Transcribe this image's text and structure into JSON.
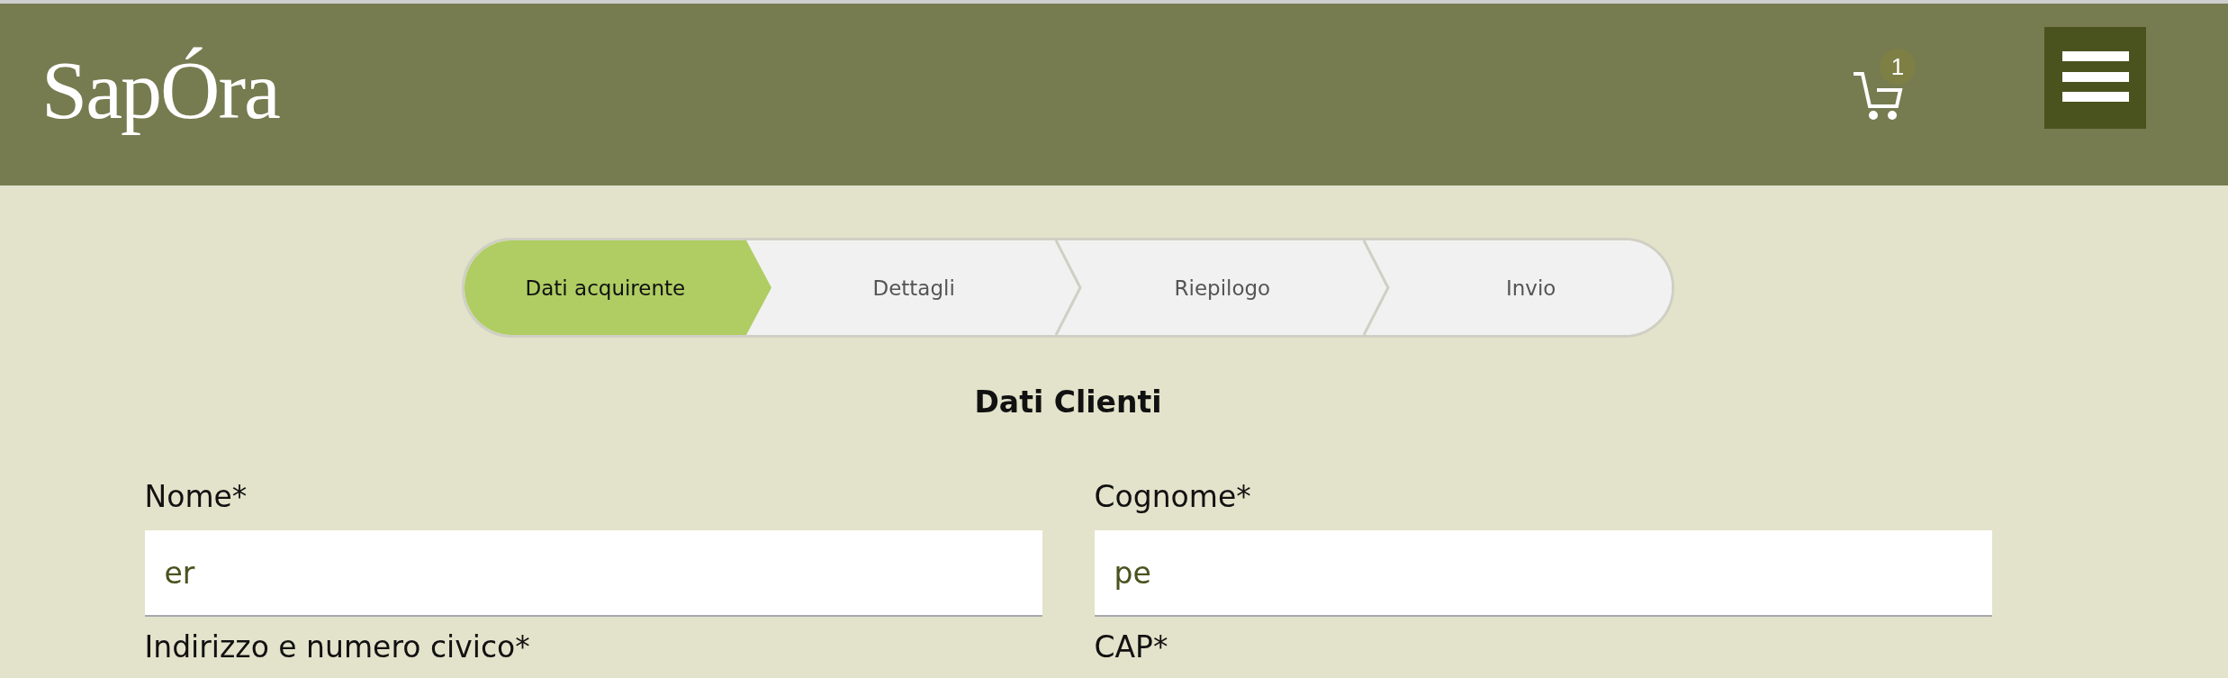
{
  "header": {
    "logo": "SapÓra",
    "cart": {
      "count": "1"
    }
  },
  "steps": [
    {
      "label": "Dati acquirente",
      "selected": true
    },
    {
      "label": "Dettagli",
      "selected": false
    },
    {
      "label": "Riepilogo",
      "selected": false
    },
    {
      "label": "Invio",
      "selected": false
    }
  ],
  "form": {
    "title": "Dati Clienti",
    "fields": [
      {
        "label": "Nome*",
        "value": "er"
      },
      {
        "label": "Cognome*",
        "value": "pe"
      },
      {
        "label": "Indirizzo e numero civico*"
      },
      {
        "label": "CAP*"
      }
    ]
  }
}
